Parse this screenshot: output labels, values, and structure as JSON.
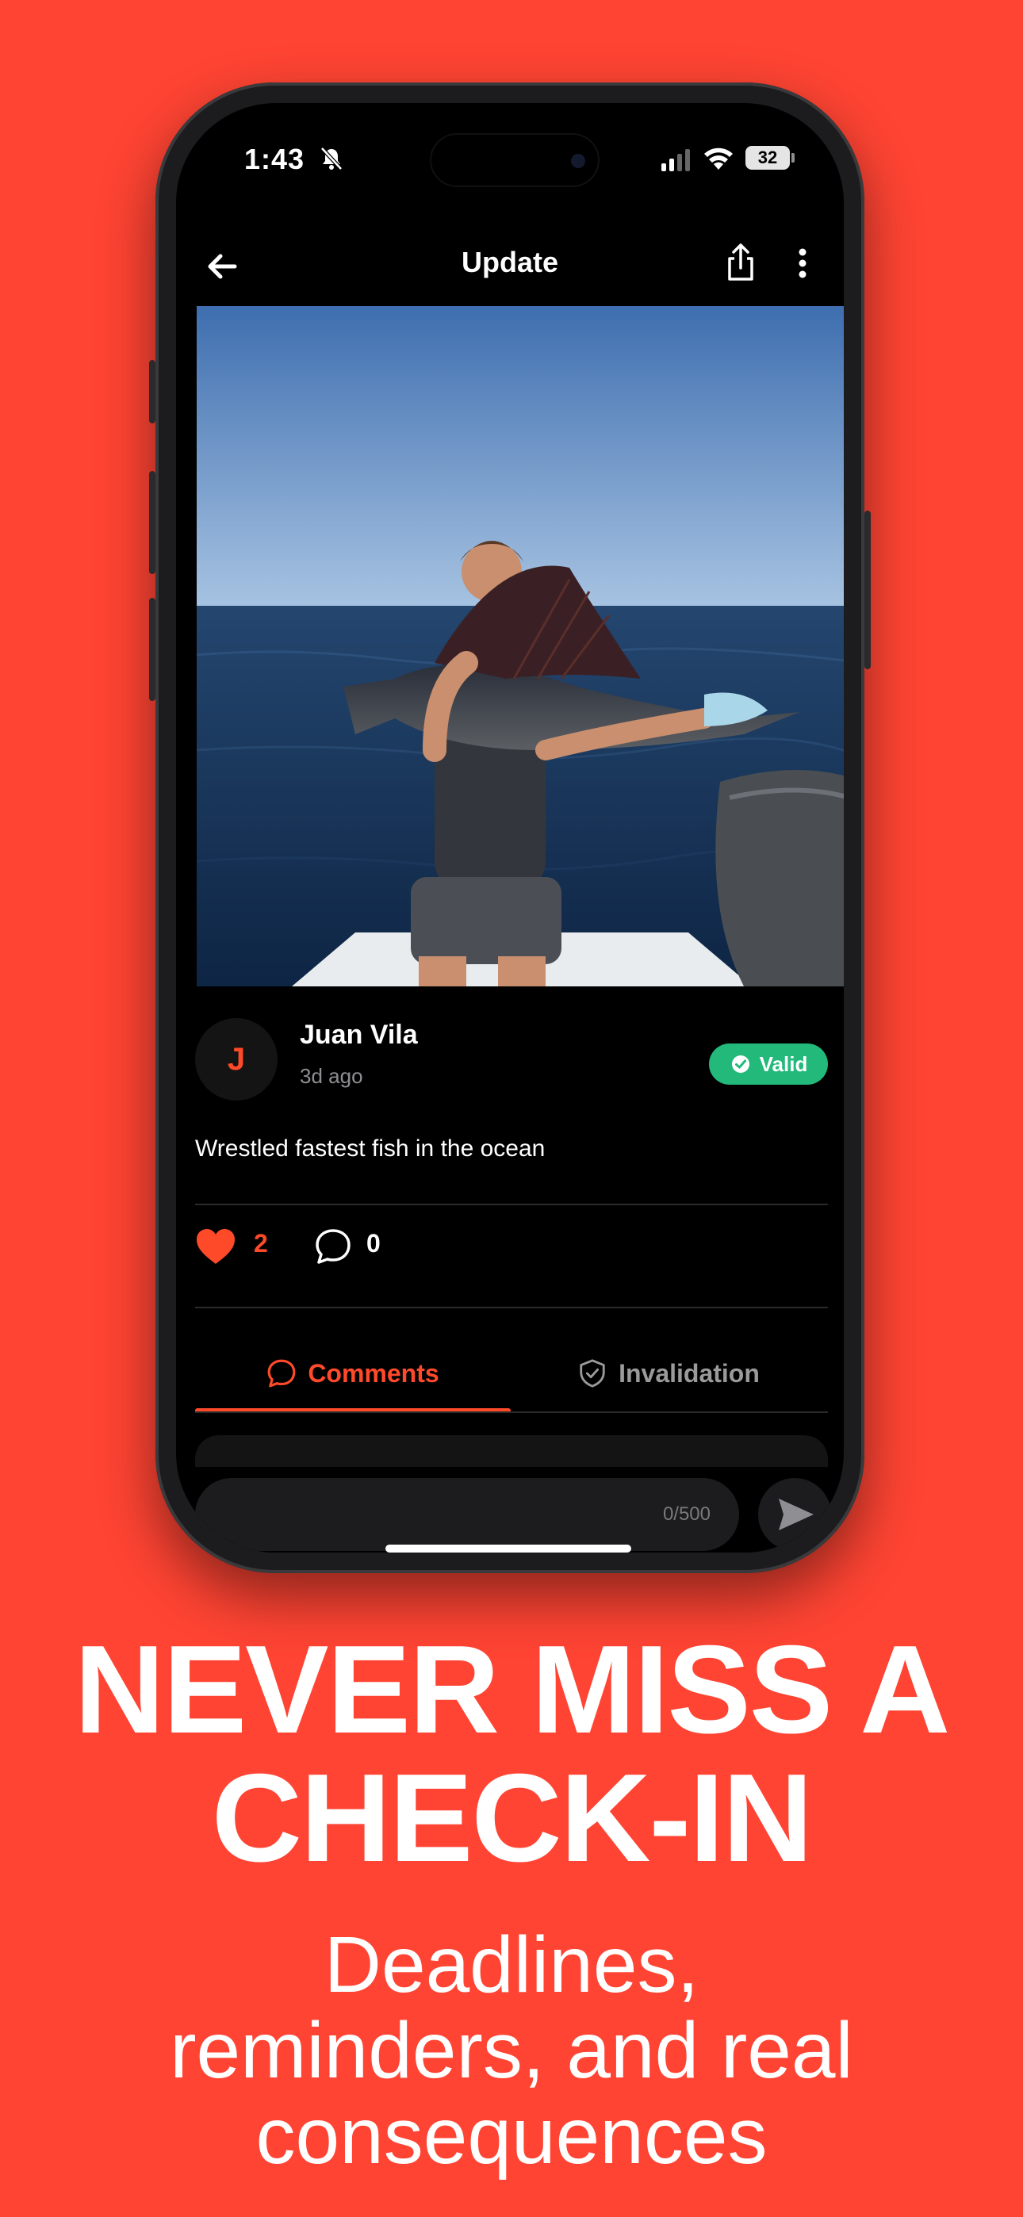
{
  "status_bar": {
    "time": "1:43",
    "battery": "32"
  },
  "nav": {
    "title": "Update"
  },
  "post": {
    "avatar_initial": "J",
    "author": "Juan Vila",
    "time_ago": "3d ago",
    "badge": "Valid",
    "caption": "Wrestled fastest fish in the ocean",
    "likes": "2",
    "comments": "0"
  },
  "tabs": [
    {
      "label": "Comments",
      "active": true
    },
    {
      "label": "Invalidation",
      "active": false
    }
  ],
  "composer": {
    "counter": "0/500"
  },
  "promo": {
    "headline_line1": "NEVER MISS A",
    "headline_line2": "CHECK-IN",
    "sub_line1": "Deadlines,",
    "sub_line2": "reminders, and real",
    "sub_line3": "consequences"
  },
  "colors": {
    "background": "#FF4433",
    "accent": "#FF4A2A",
    "valid": "#22B97A"
  },
  "icons": [
    "back-arrow-icon",
    "share-icon",
    "more-vertical-icon",
    "heart-icon",
    "comment-bubble-icon",
    "shield-check-icon",
    "send-icon",
    "bell-slash-icon",
    "signal-icon",
    "wifi-icon"
  ]
}
